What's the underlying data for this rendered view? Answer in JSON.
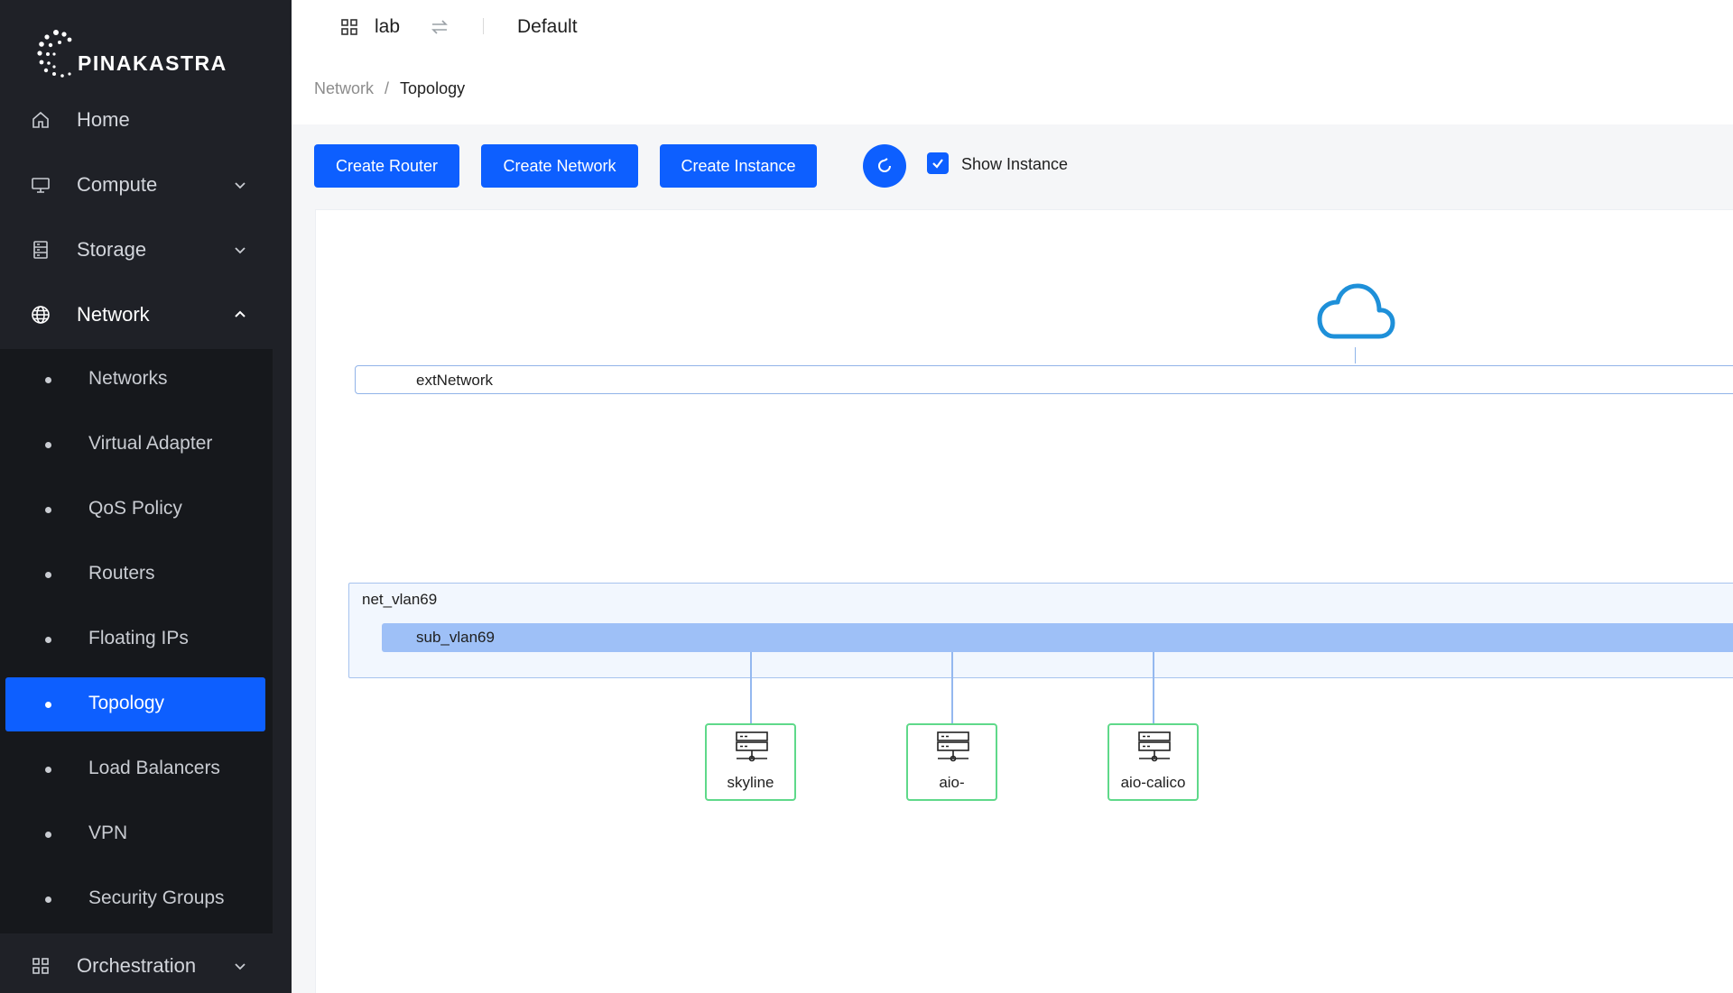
{
  "brand": {
    "name": "PINAKASTRA"
  },
  "sidebar": {
    "items": [
      {
        "label": "Home",
        "icon": "home-icon"
      },
      {
        "label": "Compute",
        "icon": "monitor-icon"
      },
      {
        "label": "Storage",
        "icon": "storage-icon"
      },
      {
        "label": "Network",
        "icon": "globe-icon"
      },
      {
        "label": "Orchestration",
        "icon": "grid-icon"
      }
    ],
    "network_sub": [
      {
        "label": "Networks"
      },
      {
        "label": "Virtual Adapter"
      },
      {
        "label": "QoS Policy"
      },
      {
        "label": "Routers"
      },
      {
        "label": "Floating IPs"
      },
      {
        "label": "Topology"
      },
      {
        "label": "Load Balancers"
      },
      {
        "label": "VPN"
      },
      {
        "label": "Security Groups"
      }
    ],
    "selected": "Topology"
  },
  "header": {
    "project": "lab",
    "domain": "Default"
  },
  "breadcrumb": {
    "parent": "Network",
    "current": "Topology"
  },
  "toolbar": {
    "create_router": "Create Router",
    "create_network": "Create Network",
    "create_instance": "Create Instance",
    "show_instance_label": "Show Instance",
    "show_instance_checked": true
  },
  "topology": {
    "external_network": "extNetwork",
    "network": "net_vlan69",
    "subnet": "sub_vlan69",
    "instances": [
      {
        "name": "skyline"
      },
      {
        "name": "aio-"
      },
      {
        "name": "aio-calico"
      }
    ]
  },
  "colors": {
    "primary": "#0d5fff",
    "sidebar_bg": "#1f2127",
    "cloud": "#1e90d9",
    "instance_border": "#5fd98a",
    "subnet": "#9ec0f7"
  }
}
